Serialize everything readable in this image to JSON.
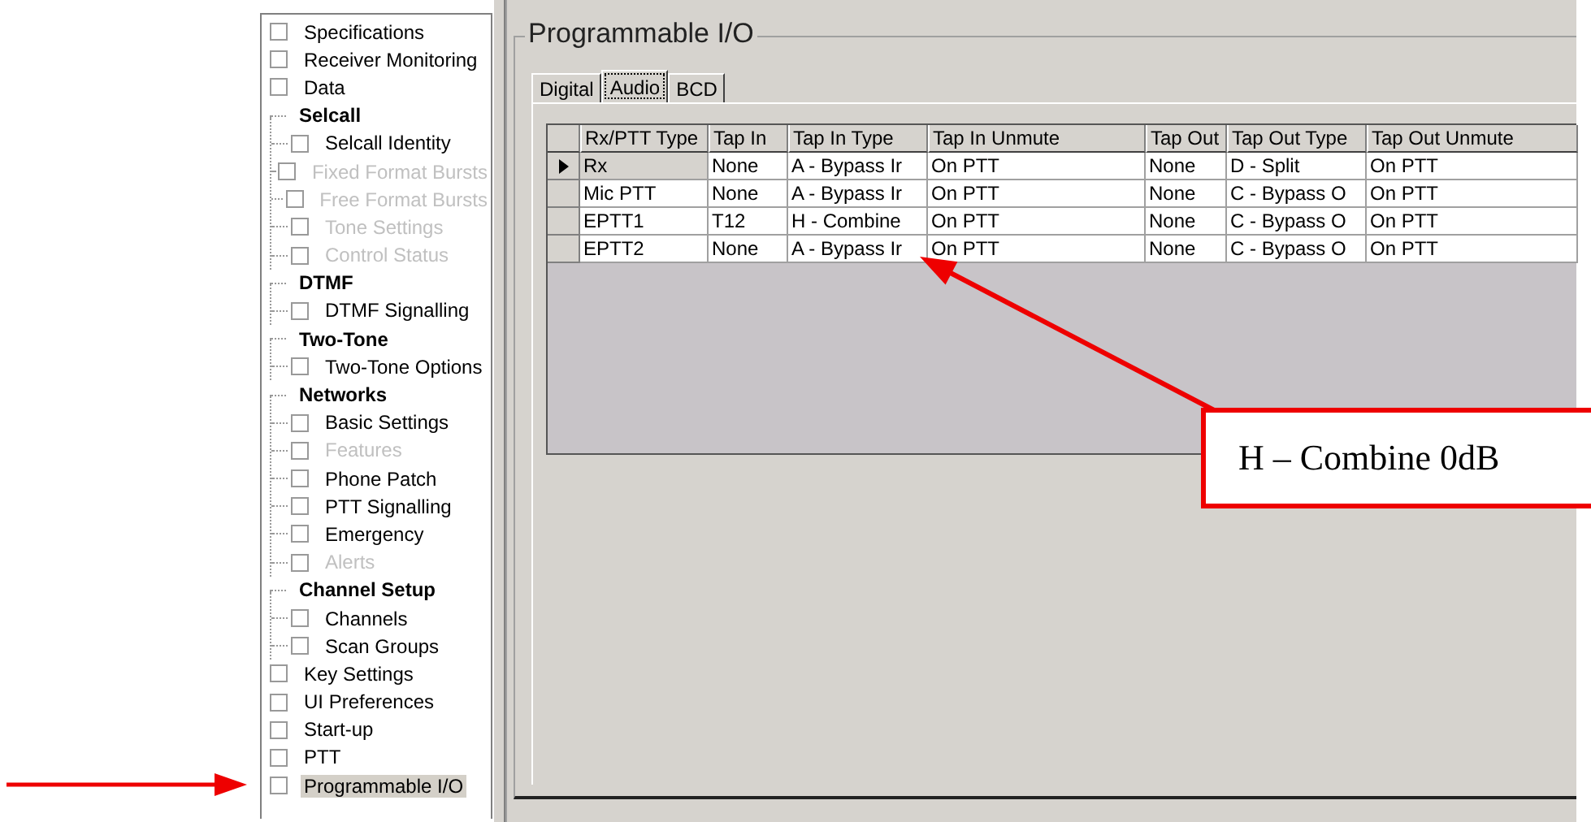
{
  "tree": [
    {
      "kind": "item",
      "label": "Specifications",
      "checked": false,
      "selected": false,
      "disabled": false
    },
    {
      "kind": "item",
      "label": "Receiver Monitoring",
      "checked": false,
      "selected": false,
      "disabled": false
    },
    {
      "kind": "item",
      "label": "Data",
      "checked": false,
      "selected": false,
      "disabled": false
    },
    {
      "kind": "group",
      "label": "Selcall",
      "children": [
        {
          "kind": "item",
          "label": "Selcall Identity",
          "checked": false,
          "selected": false,
          "disabled": false
        },
        {
          "kind": "item",
          "label": "Fixed Format Bursts",
          "checked": false,
          "selected": false,
          "disabled": true
        },
        {
          "kind": "item",
          "label": "Free Format Bursts",
          "checked": false,
          "selected": false,
          "disabled": true
        },
        {
          "kind": "item",
          "label": "Tone Settings",
          "checked": false,
          "selected": false,
          "disabled": true
        },
        {
          "kind": "item",
          "label": "Control Status",
          "checked": false,
          "selected": false,
          "disabled": true
        }
      ]
    },
    {
      "kind": "group",
      "label": "DTMF",
      "children": [
        {
          "kind": "item",
          "label": "DTMF Signalling",
          "checked": false,
          "selected": false,
          "disabled": false
        }
      ]
    },
    {
      "kind": "group",
      "label": "Two-Tone",
      "children": [
        {
          "kind": "item",
          "label": "Two-Tone Options",
          "checked": false,
          "selected": false,
          "disabled": false
        }
      ]
    },
    {
      "kind": "group",
      "label": "Networks",
      "children": [
        {
          "kind": "item",
          "label": "Basic Settings",
          "checked": false,
          "selected": false,
          "disabled": false
        },
        {
          "kind": "item",
          "label": "Features",
          "checked": false,
          "selected": false,
          "disabled": true
        },
        {
          "kind": "item",
          "label": "Phone Patch",
          "checked": false,
          "selected": false,
          "disabled": false
        },
        {
          "kind": "item",
          "label": "PTT Signalling",
          "checked": false,
          "selected": false,
          "disabled": false
        },
        {
          "kind": "item",
          "label": "Emergency",
          "checked": false,
          "selected": false,
          "disabled": false
        },
        {
          "kind": "item",
          "label": "Alerts",
          "checked": false,
          "selected": false,
          "disabled": true
        }
      ]
    },
    {
      "kind": "group",
      "label": "Channel Setup",
      "children": [
        {
          "kind": "item",
          "label": "Channels",
          "checked": false,
          "selected": false,
          "disabled": false
        },
        {
          "kind": "item",
          "label": "Scan Groups",
          "checked": false,
          "selected": false,
          "disabled": false
        }
      ]
    },
    {
      "kind": "item",
      "label": "Key Settings",
      "checked": false,
      "selected": false,
      "disabled": false
    },
    {
      "kind": "item",
      "label": "UI Preferences",
      "checked": false,
      "selected": false,
      "disabled": false
    },
    {
      "kind": "item",
      "label": "Start-up",
      "checked": false,
      "selected": false,
      "disabled": false
    },
    {
      "kind": "item",
      "label": "PTT",
      "checked": false,
      "selected": false,
      "disabled": false
    },
    {
      "kind": "item",
      "label": "Programmable I/O",
      "checked": false,
      "selected": true,
      "disabled": false
    }
  ],
  "group_box": {
    "title": "Programmable I/O"
  },
  "tabs": [
    {
      "label": "Digital",
      "selected": false
    },
    {
      "label": "Audio",
      "selected": true
    },
    {
      "label": "BCD",
      "selected": false
    }
  ],
  "table": {
    "columns": [
      "Rx/PTT Type",
      "Tap In",
      "Tap In Type",
      "Tap In Unmute",
      "Tap Out",
      "Tap Out Type",
      "Tap Out Unmute"
    ],
    "rows": [
      {
        "selected": true,
        "cells": [
          "Rx",
          "None",
          "A - Bypass Ir",
          "On PTT",
          "None",
          "D - Split",
          "On PTT"
        ]
      },
      {
        "selected": false,
        "cells": [
          "Mic PTT",
          "None",
          "A - Bypass Ir",
          "On PTT",
          "None",
          "C - Bypass O",
          "On PTT"
        ]
      },
      {
        "selected": false,
        "cells": [
          "EPTT1",
          "T12",
          "H - Combine",
          "On PTT",
          "None",
          "C - Bypass O",
          "On PTT"
        ]
      },
      {
        "selected": false,
        "cells": [
          "EPTT2",
          "None",
          "A - Bypass Ir",
          "On PTT",
          "None",
          "C - Bypass O",
          "On PTT"
        ]
      }
    ]
  },
  "callout": {
    "text": "H – Combine 0dB"
  }
}
